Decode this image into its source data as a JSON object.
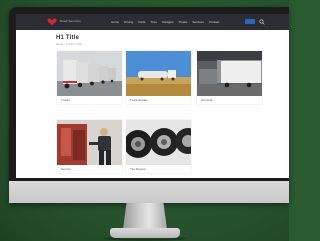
{
  "colors": {
    "background": "#2a5a30",
    "navbar": "#2b2d33",
    "accent_button": "#2a62c8",
    "logo_red": "#d8262c"
  },
  "site": {
    "logo_text": "Road Services",
    "menu": [
      "Home",
      "Driving",
      "Parts",
      "Tires",
      "Garages",
      "Trucks",
      "Services",
      "Contact"
    ],
    "search_icon": "search-icon"
  },
  "page": {
    "title": "H1 Title",
    "breadcrumb": "Home > Trucks > Fleet"
  },
  "gallery": [
    {
      "caption": "Trucks",
      "image": "truck-fleet-photo"
    },
    {
      "caption": "Truck Routes",
      "image": "tanker-field-photo"
    },
    {
      "caption": "Terminal",
      "image": "loading-dock-photo"
    },
    {
      "caption": "Service",
      "image": "mechanic-photo"
    },
    {
      "caption": "Tire Depots",
      "image": "tires-photo"
    }
  ]
}
